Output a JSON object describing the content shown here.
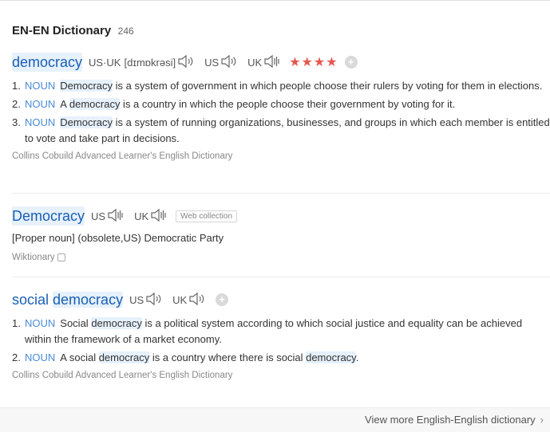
{
  "header": {
    "title": "EN-EN Dictionary",
    "count": "246"
  },
  "entries": [
    {
      "headword": "democracy",
      "pron_label_usuk": "US·UK",
      "ipa": "[dɪmɒkrəsi]",
      "pron_label_us": "US",
      "pron_label_uk": "UK",
      "stars": "★★★★",
      "definitions": [
        {
          "num": "1.",
          "pos": "NOUN",
          "pre": "",
          "kw": "Democracy",
          "post": " is a system of government in which people choose their rulers by voting for them in elections."
        },
        {
          "num": "2.",
          "pos": "NOUN",
          "pre": "A ",
          "kw": "democracy",
          "post": " is a country in which the people choose their government by voting for it."
        },
        {
          "num": "3.",
          "pos": "NOUN",
          "pre": "",
          "kw": "Democracy",
          "post": " is a system of running organizations, businesses, and groups in which each member is entitled to vote and take part in decisions."
        }
      ],
      "source": "Collins Cobuild Advanced Learner's English Dictionary"
    },
    {
      "headword": "Democracy",
      "pron_label_us": "US",
      "pron_label_uk": "UK",
      "web_collection": "Web collection",
      "definition": "[Proper noun] (obsolete,US) Democratic Party",
      "source": "Wiktionary"
    },
    {
      "headword_pre": "social ",
      "headword_kw": "democracy",
      "pron_label_us": "US",
      "pron_label_uk": "UK",
      "definitions": [
        {
          "num": "1.",
          "pos": "NOUN",
          "pre": "Social ",
          "kw": "democracy",
          "post": " is a political system according to which social justice and equality can be achieved within the framework of a market economy."
        },
        {
          "num": "2.",
          "pos": "NOUN",
          "pre": "A social ",
          "kw": "democracy",
          "post": " is a country where there is social ",
          "kw2": "democracy",
          "post2": "."
        }
      ],
      "source": "Collins Cobuild Advanced Learner's English Dictionary"
    }
  ],
  "footer": {
    "more_label": "View more English-English dictionary",
    "chevron": "›"
  },
  "icons": {
    "speaker": "speaker-icon",
    "add": "add-icon",
    "copy": "copy-icon"
  },
  "colors": {
    "link": "#1a5fb4",
    "pos": "#4a8bd6",
    "stars": "#e5584f",
    "highlight": "#e6f1fb"
  }
}
